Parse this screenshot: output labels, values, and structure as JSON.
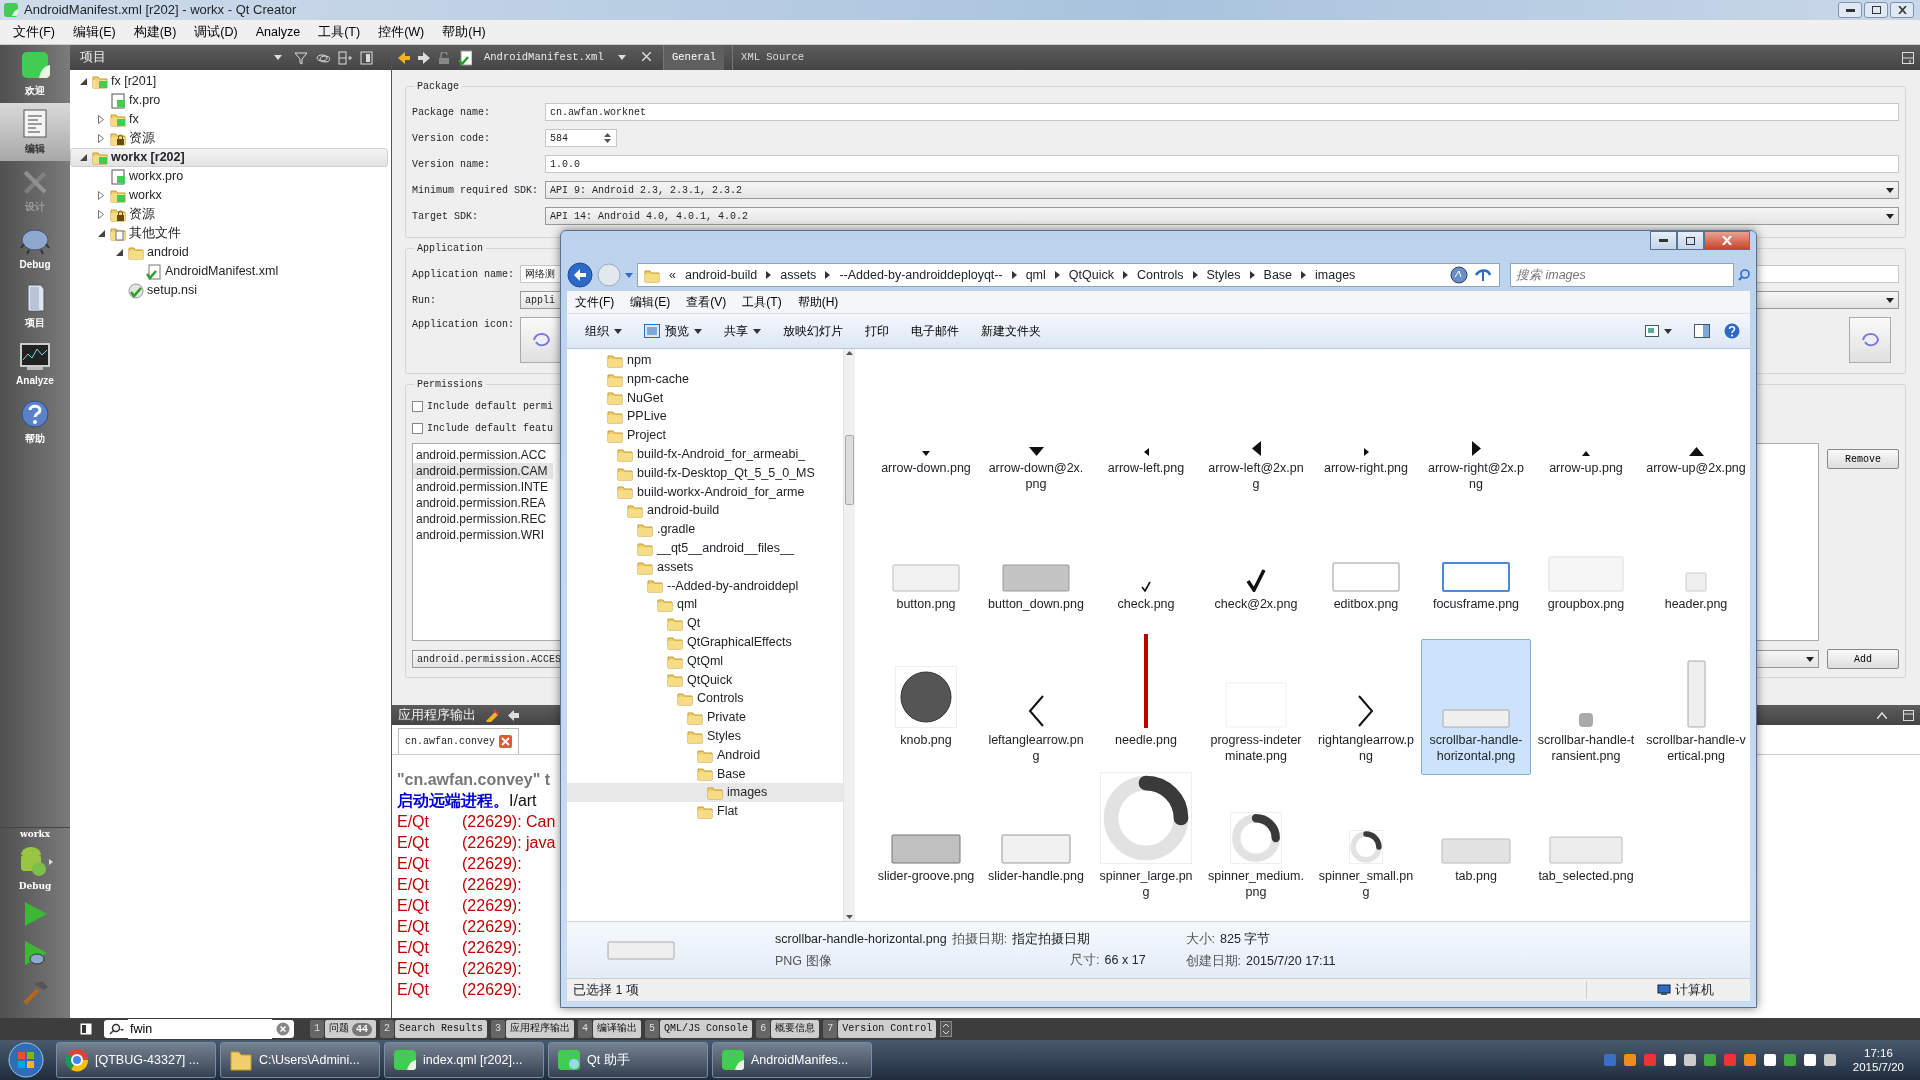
{
  "window": {
    "title": "AndroidManifest.xml [r202] - workx - Qt Creator"
  },
  "menu": [
    "文件(F)",
    "编辑(E)",
    "构建(B)",
    "调试(D)",
    "Analyze",
    "工具(T)",
    "控件(W)",
    "帮助(H)"
  ],
  "mode_bar": [
    {
      "label": "欢迎",
      "kind": "welcome",
      "selected": false,
      "disabled": false
    },
    {
      "label": "编辑",
      "kind": "edit",
      "selected": true,
      "disabled": false
    },
    {
      "label": "设计",
      "kind": "design",
      "selected": false,
      "disabled": true
    },
    {
      "label": "Debug",
      "kind": "debug",
      "selected": false,
      "disabled": false
    },
    {
      "label": "项目",
      "kind": "projects",
      "selected": false,
      "disabled": false
    },
    {
      "label": "Analyze",
      "kind": "analyze",
      "selected": false,
      "disabled": false
    },
    {
      "label": "帮助",
      "kind": "help",
      "selected": false,
      "disabled": false
    }
  ],
  "kit": {
    "project": "workx",
    "config": "Debug"
  },
  "project_pane": {
    "title": "项目",
    "tree": [
      {
        "label": "fx [r201]",
        "kind": "project",
        "active": false,
        "expanded": true,
        "selected": false,
        "children": [
          {
            "label": "fx.pro",
            "kind": "pro",
            "selected": false
          },
          {
            "label": "fx",
            "kind": "qt-folder",
            "expanded": false,
            "selected": false
          },
          {
            "label": "资源",
            "kind": "resources",
            "expanded": false,
            "selected": false
          }
        ]
      },
      {
        "label": "workx [r202]",
        "kind": "project",
        "active": true,
        "expanded": true,
        "selected": true,
        "children": [
          {
            "label": "workx.pro",
            "kind": "pro",
            "selected": false
          },
          {
            "label": "workx",
            "kind": "qt-folder",
            "expanded": false,
            "selected": false
          },
          {
            "label": "资源",
            "kind": "resources",
            "expanded": false,
            "selected": false
          },
          {
            "label": "其他文件",
            "kind": "other",
            "expanded": true,
            "selected": false,
            "children": [
              {
                "label": "android",
                "kind": "folder",
                "expanded": true,
                "selected": false,
                "children": [
                  {
                    "label": "AndroidManifest.xml",
                    "kind": "xml",
                    "selected": false
                  }
                ]
              },
              {
                "label": "setup.nsi",
                "kind": "nsi",
                "selected": false
              }
            ]
          }
        ]
      }
    ]
  },
  "editor": {
    "file": "AndroidManifest.xml",
    "tabs": [
      {
        "label": "General",
        "selected": true
      },
      {
        "label": "XML Source",
        "selected": false
      }
    ]
  },
  "package": {
    "title": "Package",
    "fields": [
      {
        "label": "Package name:",
        "value": "cn.awfan.worknet",
        "kind": "text"
      },
      {
        "label": "Version code:",
        "value": "584",
        "kind": "spin"
      },
      {
        "label": "Version name:",
        "value": "1.0.0",
        "kind": "text"
      },
      {
        "label": "Minimum required SDK:",
        "value": "API 9: Android 2.3, 2.3.1, 2.3.2",
        "kind": "combo"
      },
      {
        "label": "Target SDK:",
        "value": "API 14: Android 4.0, 4.0.1, 4.0.2",
        "kind": "combo"
      }
    ]
  },
  "application": {
    "title": "Application",
    "fields": [
      {
        "label": "Application name:",
        "value": "网络测",
        "kind": "text"
      },
      {
        "label": "Run:",
        "value": "appli",
        "kind": "combo"
      },
      {
        "label": "Application icon:",
        "kind": "icons"
      }
    ]
  },
  "permissions": {
    "title": "Permissions",
    "options": [
      {
        "label": "Include default permi",
        "checked": false
      },
      {
        "label": "Include default featu",
        "checked": false
      }
    ],
    "list": [
      {
        "label": "android.permission.ACC",
        "selected": false
      },
      {
        "label": "android.permission.CAM",
        "selected": true
      },
      {
        "label": "android.permission.INTE",
        "selected": false
      },
      {
        "label": "android.permission.REA",
        "selected": false
      },
      {
        "label": "android.permission.REC",
        "selected": false
      },
      {
        "label": "android.permission.WRI",
        "selected": false
      }
    ],
    "combo": "android.permission.ACCES",
    "remove": "Remove",
    "add": "Add"
  },
  "output": {
    "title": "应用程序输出",
    "tab": "cn.awfan.convey",
    "lines": [
      [
        {
          "text": "\"cn.awfan.convey\" t",
          "kind": "process"
        }
      ],
      [
        {
          "text": "启动远端进程。",
          "kind": "remote"
        },
        {
          "text": "I/art",
          "kind": "plain"
        }
      ],
      [
        {
          "text": "E/Qt",
          "kind": "tag"
        },
        {
          "text": "(22629): Can",
          "kind": "error"
        }
      ],
      [
        {
          "text": "E/Qt",
          "kind": "tag"
        },
        {
          "text": "(22629): java",
          "kind": "error"
        }
      ],
      [
        {
          "text": "E/Qt",
          "kind": "tag"
        },
        {
          "text": "(22629):",
          "kind": "error"
        }
      ],
      [
        {
          "text": "E/Qt",
          "kind": "tag"
        },
        {
          "text": "(22629):",
          "kind": "error"
        }
      ],
      [
        {
          "text": "E/Qt",
          "kind": "tag"
        },
        {
          "text": "(22629):",
          "kind": "error"
        }
      ],
      [
        {
          "text": "E/Qt",
          "kind": "tag"
        },
        {
          "text": "(22629):",
          "kind": "error"
        }
      ],
      [
        {
          "text": "E/Qt",
          "kind": "tag"
        },
        {
          "text": "(22629):",
          "kind": "error"
        }
      ],
      [
        {
          "text": "E/Qt",
          "kind": "tag"
        },
        {
          "text": "(22629):",
          "kind": "error"
        }
      ],
      [
        {
          "text": "E/Qt",
          "kind": "tag"
        },
        {
          "text": "(22629):",
          "kind": "error"
        }
      ]
    ]
  },
  "bottom_bar": {
    "search": "fwin",
    "tabs": [
      {
        "number": "1",
        "label": "问题",
        "count": "44"
      },
      {
        "number": "2",
        "label": "Search Results"
      },
      {
        "number": "3",
        "label": "应用程序输出"
      },
      {
        "number": "4",
        "label": "编译输出"
      },
      {
        "number": "5",
        "label": "QML/JS Console"
      },
      {
        "number": "6",
        "label": "概要信息"
      },
      {
        "number": "7",
        "label": "Version Control"
      }
    ]
  },
  "explorer": {
    "overflow": "«",
    "path": [
      "android-build",
      "assets",
      "--Added-by-androiddeployqt--",
      "qml",
      "QtQuick",
      "Controls",
      "Styles",
      "Base",
      "images"
    ],
    "search": {
      "placeholder": "搜索 images"
    },
    "menu": [
      "文件(F)",
      "编辑(E)",
      "查看(V)",
      "工具(T)",
      "帮助(H)"
    ],
    "toolbar": [
      {
        "label": "组织",
        "kind": "menu"
      },
      {
        "label": "预览",
        "kind": "menu-icon"
      },
      {
        "label": "共享",
        "kind": "menu"
      },
      {
        "label": "放映幻灯片",
        "kind": "plain"
      },
      {
        "label": "打印",
        "kind": "plain"
      },
      {
        "label": "电子邮件",
        "kind": "plain"
      },
      {
        "label": "新建文件夹",
        "kind": "plain"
      }
    ],
    "tree": [
      {
        "label": "npm",
        "selected": false
      },
      {
        "label": "npm-cache",
        "selected": false
      },
      {
        "label": "NuGet",
        "selected": false
      },
      {
        "label": "PPLive",
        "selected": false
      },
      {
        "label": "Project",
        "selected": false,
        "children": [
          {
            "label": "build-fx-Android_for_armeabi_",
            "selected": false
          },
          {
            "label": "build-fx-Desktop_Qt_5_5_0_MS",
            "selected": false
          },
          {
            "label": "build-workx-Android_for_arme",
            "selected": false,
            "children": [
              {
                "label": "android-build",
                "selected": false,
                "children": [
                  {
                    "label": ".gradle",
                    "selected": false
                  },
                  {
                    "label": "__qt5__android__files__",
                    "selected": false
                  },
                  {
                    "label": "assets",
                    "selected": false,
                    "children": [
                      {
                        "label": "--Added-by-androiddepl",
                        "selected": false,
                        "children": [
                          {
                            "label": "qml",
                            "selected": false,
                            "children": [
                              {
                                "label": "Qt",
                                "selected": false
                              },
                              {
                                "label": "QtGraphicalEffects",
                                "selected": false
                              },
                              {
                                "label": "QtQml",
                                "selected": false
                              },
                              {
                                "label": "QtQuick",
                                "selected": false,
                                "children": [
                                  {
                                    "label": "Controls",
                                    "selected": false,
                                    "children": [
                                      {
                                        "label": "Private",
                                        "selected": false
                                      },
                                      {
                                        "label": "Styles",
                                        "selected": false,
                                        "children": [
                                          {
                                            "label": "Android",
                                            "selected": false
                                          },
                                          {
                                            "label": "Base",
                                            "selected": false,
                                            "children": [
                                              {
                                                "label": "images",
                                                "selected": true
                                              }
                                            ]
                                          },
                                          {
                                            "label": "Flat",
                                            "selected": false
                                          }
                                        ]
                                      }
                                    ]
                                  }
                                ]
                              }
                            ]
                          }
                        ]
                      }
                    ]
                  }
                ]
              }
            ]
          }
        ]
      }
    ],
    "files": [
      {
        "name": "arrow-down.png",
        "kind": "arrow-down",
        "selected": false
      },
      {
        "name": "arrow-down@2x.png",
        "kind": "arrow-down-2x",
        "selected": false
      },
      {
        "name": "arrow-left.png",
        "kind": "arrow-left",
        "selected": false
      },
      {
        "name": "arrow-left@2x.png",
        "kind": "arrow-left-2x",
        "selected": false
      },
      {
        "name": "arrow-right.png",
        "kind": "arrow-right",
        "selected": false
      },
      {
        "name": "arrow-right@2x.png",
        "kind": "arrow-right-2x",
        "selected": false
      },
      {
        "name": "arrow-up.png",
        "kind": "arrow-up",
        "selected": false
      },
      {
        "name": "arrow-up@2x.png",
        "kind": "arrow-up-2x",
        "selected": false
      },
      {
        "name": "button.png",
        "kind": "button",
        "selected": false
      },
      {
        "name": "button_down.png",
        "kind": "button-down",
        "selected": false
      },
      {
        "name": "check.png",
        "kind": "check",
        "selected": false
      },
      {
        "name": "check@2x.png",
        "kind": "check-2x",
        "selected": false
      },
      {
        "name": "editbox.png",
        "kind": "editbox",
        "selected": false
      },
      {
        "name": "focusframe.png",
        "kind": "focusframe",
        "selected": false
      },
      {
        "name": "groupbox.png",
        "kind": "groupbox",
        "selected": false
      },
      {
        "name": "header.png",
        "kind": "header",
        "selected": false
      },
      {
        "name": "knob.png",
        "kind": "knob",
        "selected": false
      },
      {
        "name": "leftanglearrow.png",
        "kind": "left-angle",
        "selected": false
      },
      {
        "name": "needle.png",
        "kind": "needle",
        "selected": false
      },
      {
        "name": "progress-indeterminate.png",
        "kind": "progress",
        "selected": false
      },
      {
        "name": "rightanglearrow.png",
        "kind": "right-angle",
        "selected": false
      },
      {
        "name": "scrollbar-handle-horizontal.png",
        "kind": "scroll-h",
        "selected": true
      },
      {
        "name": "scrollbar-handle-transient.png",
        "kind": "scroll-transient",
        "selected": false
      },
      {
        "name": "scrollbar-handle-vertical.png",
        "kind": "scroll-v",
        "selected": false
      },
      {
        "name": "slider-groove.png",
        "kind": "slider-groove",
        "selected": false
      },
      {
        "name": "slider-handle.png",
        "kind": "slider-handle",
        "selected": false
      },
      {
        "name": "spinner_large.png",
        "kind": "spinner-large",
        "selected": false
      },
      {
        "name": "spinner_medium.png",
        "kind": "spinner-medium",
        "selected": false
      },
      {
        "name": "spinner_small.png",
        "kind": "spinner-small",
        "selected": false
      },
      {
        "name": "tab.png",
        "kind": "tab",
        "selected": false
      },
      {
        "name": "tab_selected.png",
        "kind": "tab-selected",
        "selected": false
      }
    ],
    "details": {
      "name": "scrollbar-handle-horizontal.png",
      "type": "PNG 图像",
      "kind": "scroll-h",
      "taken_label": "拍摄日期:",
      "taken": "指定拍摄日期",
      "dims_label": "尺寸:",
      "dims": "66 x 17",
      "size_label": "大小:",
      "size": "825 字节",
      "created_label": "创建日期:",
      "created": "2015/7/20 17:11"
    },
    "status": "已选择 1 项",
    "location": "计算机"
  },
  "taskbar": {
    "items": [
      {
        "label": "[QTBUG-43327] ...",
        "kind": "browser"
      },
      {
        "label": "C:\\Users\\Admini...",
        "kind": "folder"
      },
      {
        "label": "index.qml [r202]...",
        "kind": "qt"
      },
      {
        "label": "Qt 助手",
        "kind": "assistant"
      },
      {
        "label": "AndroidManifes...",
        "kind": "qt"
      }
    ],
    "time": "17:16",
    "date": "2015/7/20"
  }
}
